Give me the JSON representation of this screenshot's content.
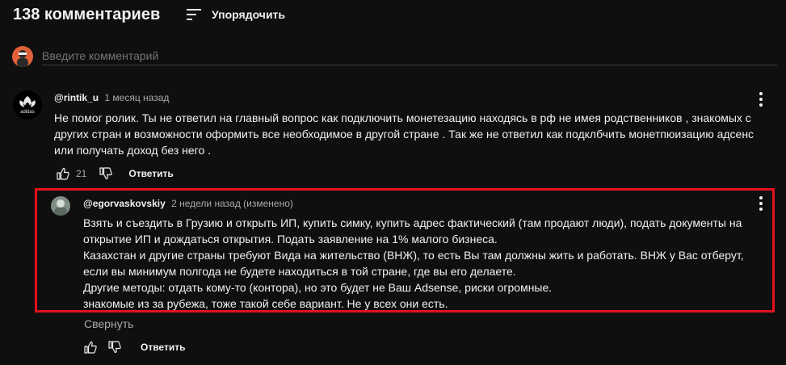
{
  "header": {
    "count_label": "138 комментариев",
    "sort_label": "Упорядочить"
  },
  "add_comment": {
    "placeholder": "Введите комментарий"
  },
  "comments": [
    {
      "author": "@rintik_u",
      "time": "1 месяц назад",
      "text": "Не помог ролик. Ты не ответил на главный вопрос как подключить монетезацию находясь в рф не имея родственников , знакомых с\nдругих стран и возможности оформить все необходимое в другой стране . Так же не ответил как подклбчить монетпюизацию адсенс\nили получать доход без него .",
      "likes": "21",
      "reply_label": "Ответить",
      "avatar_caption": "adidas"
    },
    {
      "author": "@egorvaskovskiy",
      "time": "2 недели назад (изменено)",
      "text": "Взять и съездить в Грузию и открыть ИП, купить симку, купить адрес фактический (там продают люди), подать документы на\nоткрытие ИП и дождаться открытия. Подать заявление на 1% малого бизнеса.\nКазахстан и другие страны требуют Вида на жительство (ВНЖ), то есть Вы там должны жить и работать. ВНЖ у Вас отберут,\nесли вы минимум полгода не будете находиться в той стране, где вы его делаете.\nДругие методы: отдать кому-то (контора), но это будет не Ваш Adsense, риски огромные.\nзнакомые из за рубежа, тоже такой себе вариант. Не у всех они есть.",
      "reply_label": "Ответить"
    }
  ],
  "collapse_label": "Свернуть",
  "colors": {
    "highlight": "#e5101c",
    "background": "#0f0f0f",
    "secondary_text": "#aaaaaa"
  },
  "icons": [
    "sort-icon",
    "like-icon",
    "dislike-icon",
    "more-vert-icon"
  ]
}
